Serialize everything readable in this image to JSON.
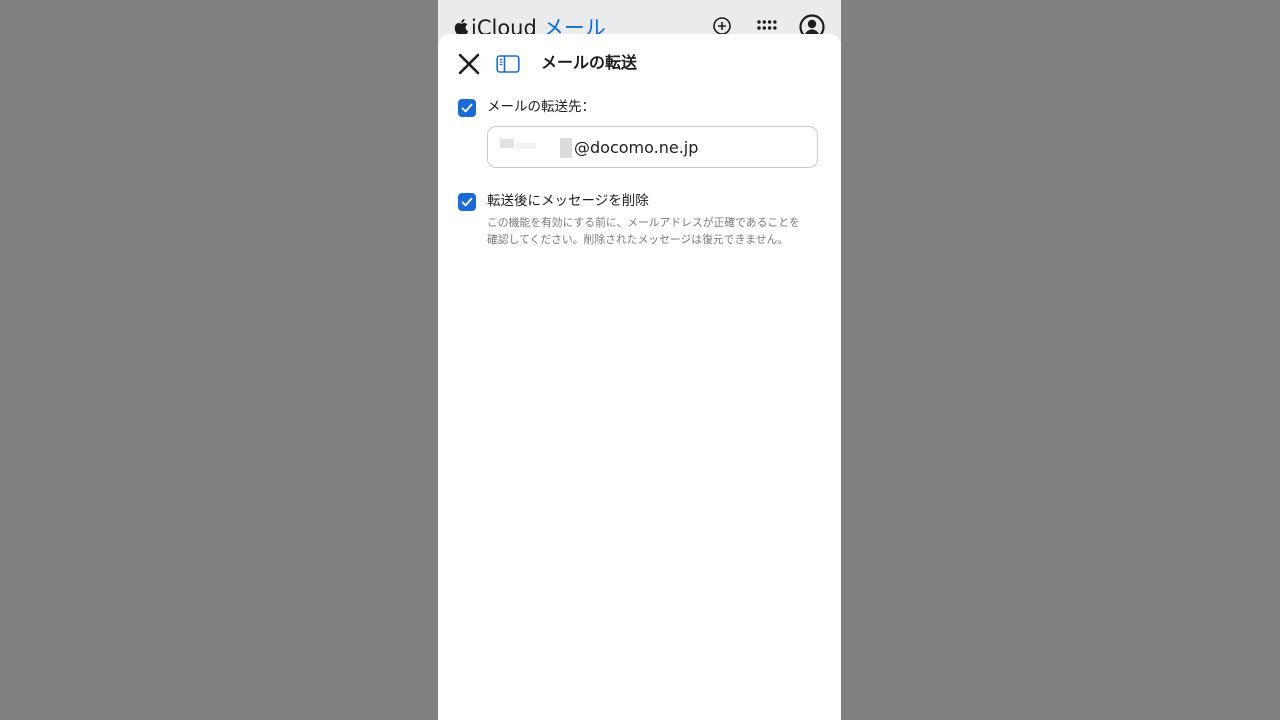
{
  "app_bar": {
    "brand": "iCloud",
    "app_name": "メール",
    "icons": [
      "apple-logo-icon",
      "plus-circle-icon",
      "app-grid-icon",
      "account-icon"
    ]
  },
  "sheet": {
    "title": "メールの転送",
    "close_icon": "close-icon",
    "sidebar_icon": "sidebar-toggle-icon"
  },
  "forward": {
    "checked": true,
    "label": "メールの転送先：",
    "address_visible": "@docomo.ne.jp"
  },
  "delete_after": {
    "checked": true,
    "label": "転送後にメッセージを削除",
    "help_line1": "この機能を有効にする前に、メールアドレスが正確であることを",
    "help_line2": "確認してください。削除されたメッセージは復元できません。"
  },
  "colors": {
    "accent": "#1a6ad9",
    "brand_blue": "#0a6fe0",
    "backdrop": "#808080"
  }
}
